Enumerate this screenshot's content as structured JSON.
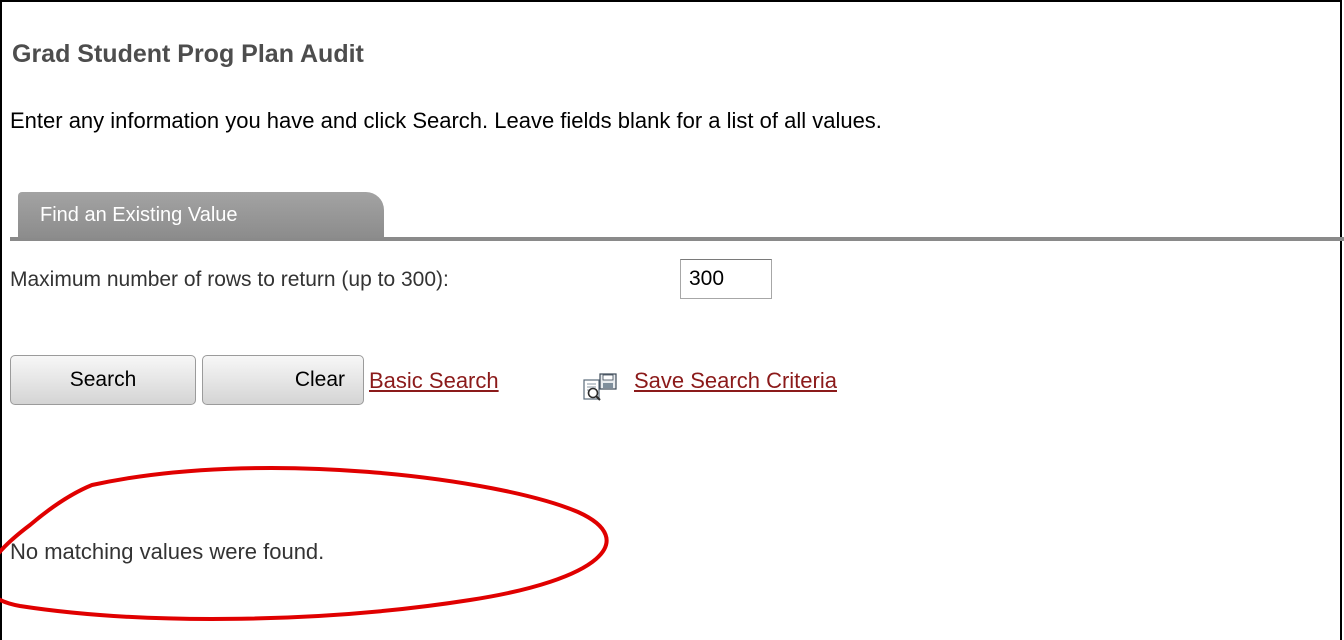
{
  "page": {
    "title": "Grad Student Prog Plan Audit",
    "instructions": "Enter any information you have and click Search. Leave fields blank for a list of all values."
  },
  "tab": {
    "label": "Find an Existing Value"
  },
  "form": {
    "max_rows_label": "Maximum number of rows to return (up to 300):",
    "max_rows_value": "300"
  },
  "actions": {
    "search_label": "Search",
    "clear_label": "Clear",
    "basic_search_label": "Basic Search",
    "save_criteria_icon": "save-search-criteria-icon",
    "save_criteria_label": "Save Search Criteria"
  },
  "results": {
    "message": "No matching values were found."
  },
  "colors": {
    "title_gray": "#4d4d4d",
    "tab_gray": "#8c8c8c",
    "link_red": "#8b1a1a",
    "annotation_red": "#e00000"
  }
}
